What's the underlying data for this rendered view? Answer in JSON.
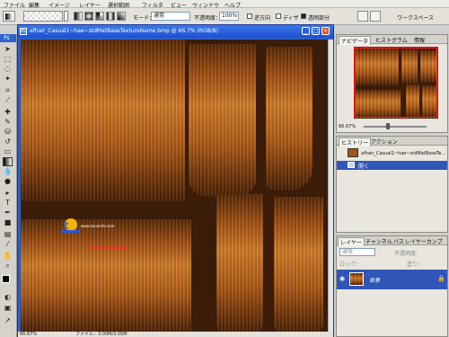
{
  "menu": {
    "items": [
      "ファイル",
      "編集",
      "イメージ",
      "レイヤー",
      "選択範囲",
      "フィルタ",
      "ビュー",
      "ウィンドウ",
      "ヘルプ"
    ]
  },
  "options": {
    "mode_label": "モード：",
    "mode_value": "通常",
    "opacity_label": "不透明度：",
    "opacity_value": "100%",
    "reverse_label": "逆方向",
    "dither_label": "ディザ",
    "transparency_label": "透明部分",
    "workspace_label": "ワークスペース"
  },
  "document": {
    "title": "afhair_Casual1~hae~stdMatBaseTextureName.bmp @ 66.7% (RGB/8)",
    "zoom": "66.67%",
    "file_info": "ファイル：3.00M/3.00M",
    "logo_url": "www.zoneinfo.com",
    "logo_warning": "No Redistribution"
  },
  "navigator": {
    "tabs": [
      "ナビゲータ",
      "ヒストグラム",
      "情報"
    ],
    "zoom": "66.67%"
  },
  "history": {
    "tabs": [
      "ヒストリー",
      "アクション"
    ],
    "snapshot": "afhair_Casual1~hae~stdMatBaseTe...",
    "step": "開く"
  },
  "layers": {
    "tabs": [
      "レイヤー",
      "チャンネル",
      "パス",
      "レイヤーカンプ"
    ],
    "blend_mode": "通常",
    "opacity_label": "不透明度：",
    "lock_label": "ロック：",
    "fill_label": "塗り：",
    "layer_name": "背景"
  },
  "colors": {
    "title_bar": "#1d4fd1",
    "selection": "#2f56b8",
    "hair_base": "#3a1c09",
    "warning_text": "#ff2a2a"
  }
}
